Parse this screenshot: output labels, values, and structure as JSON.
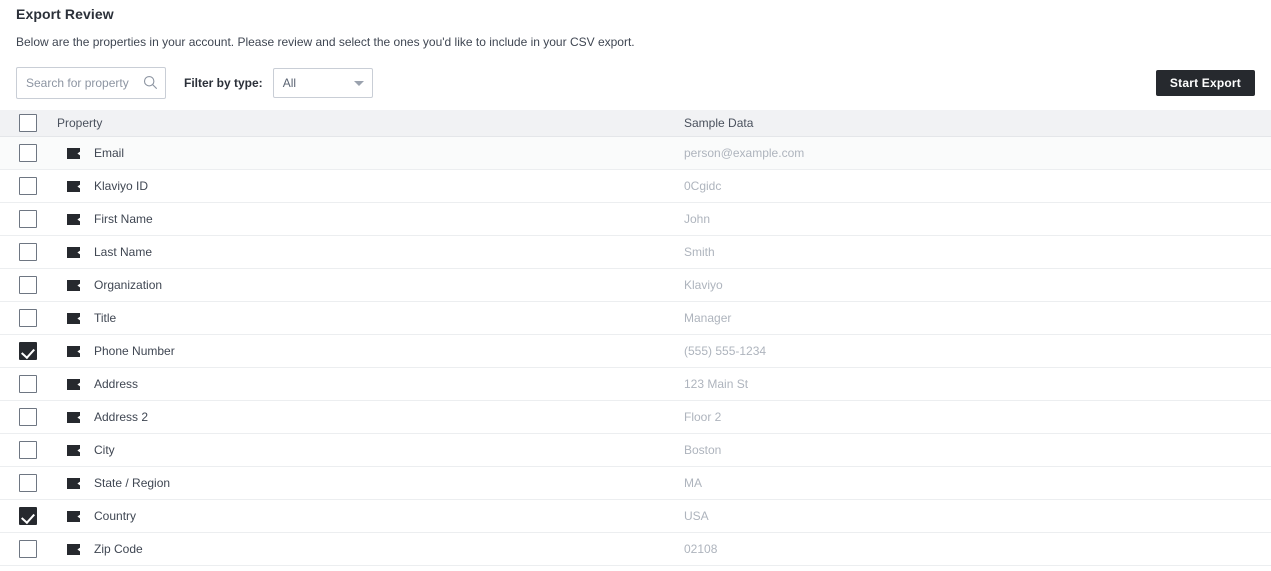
{
  "header": {
    "title": "Export Review",
    "subtitle": "Below are the properties in your account. Please review and select the ones you'd like to include in your CSV export."
  },
  "toolbar": {
    "search": {
      "placeholder": "Search for property",
      "value": "",
      "icon": "search-icon"
    },
    "filter_label": "Filter by type:",
    "filter_select": {
      "value": "All",
      "options": [
        "All"
      ],
      "icon": "chevron-down-icon"
    },
    "start_export_label": "Start Export"
  },
  "table": {
    "columns": {
      "property": "Property",
      "sample_data": "Sample Data"
    },
    "select_all_checked": false,
    "row_icon": "text-property-icon",
    "rows": [
      {
        "property": "Email",
        "sample": "person@example.com",
        "checked": false,
        "tinted": true
      },
      {
        "property": "Klaviyo ID",
        "sample": "0Cgidc",
        "checked": false,
        "tinted": false
      },
      {
        "property": "First Name",
        "sample": "John",
        "checked": false,
        "tinted": false
      },
      {
        "property": "Last Name",
        "sample": "Smith",
        "checked": false,
        "tinted": false
      },
      {
        "property": "Organization",
        "sample": "Klaviyo",
        "checked": false,
        "tinted": false
      },
      {
        "property": "Title",
        "sample": "Manager",
        "checked": false,
        "tinted": false
      },
      {
        "property": "Phone Number",
        "sample": "(555) 555-1234",
        "checked": true,
        "tinted": false
      },
      {
        "property": "Address",
        "sample": "123 Main St",
        "checked": false,
        "tinted": false
      },
      {
        "property": "Address 2",
        "sample": "Floor 2",
        "checked": false,
        "tinted": false
      },
      {
        "property": "City",
        "sample": "Boston",
        "checked": false,
        "tinted": false
      },
      {
        "property": "State / Region",
        "sample": "MA",
        "checked": false,
        "tinted": false
      },
      {
        "property": "Country",
        "sample": "USA",
        "checked": true,
        "tinted": false
      },
      {
        "property": "Zip Code",
        "sample": "02108",
        "checked": false,
        "tinted": false
      }
    ]
  },
  "colors": {
    "accent_dark": "#26292e",
    "text_primary": "#2b3039",
    "text_secondary": "#3f4652",
    "text_muted": "#aeb4bd",
    "border": "#eceef0",
    "header_bg": "#f1f2f4"
  }
}
